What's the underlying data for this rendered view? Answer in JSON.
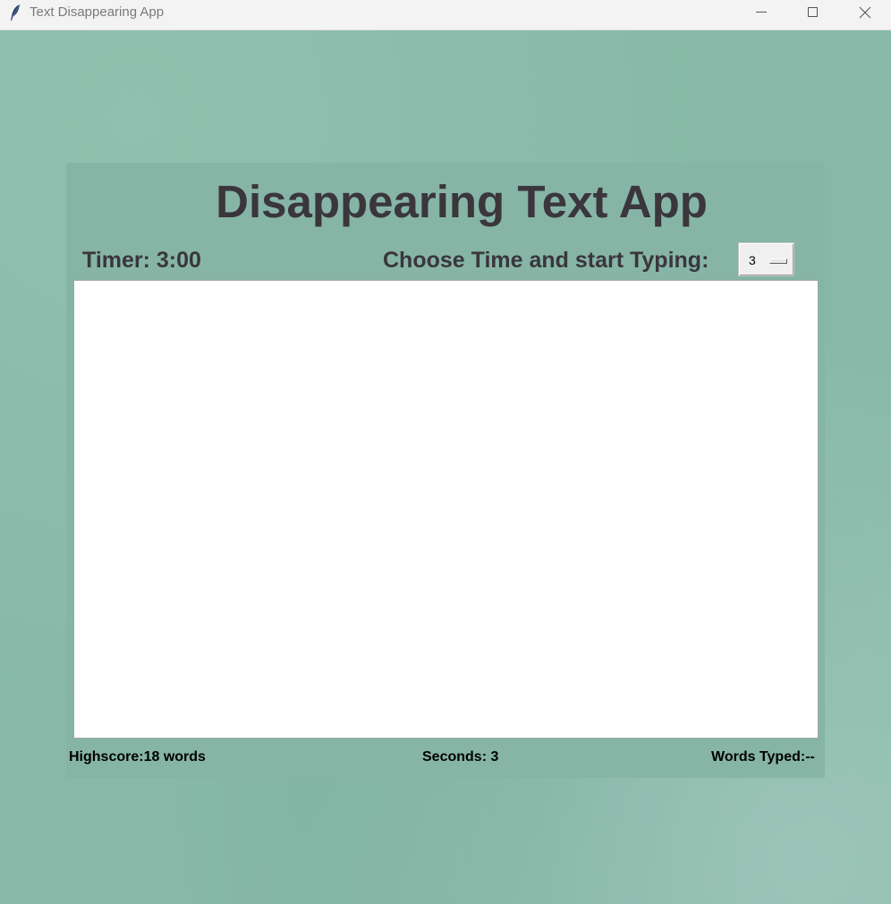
{
  "window": {
    "title": "Text Disappearing App",
    "icon": "feather-icon"
  },
  "app": {
    "heading": "Disappearing Text App",
    "timer": "Timer: 3:00",
    "choose_label": "Choose Time and start Typing:",
    "time_option": "3",
    "typing_area_text": ""
  },
  "stats": {
    "highscore": "Highscore:18 words",
    "seconds": "Seconds: 3",
    "words_typed": "Words Typed:--"
  },
  "colors": {
    "background": "#88b9a8",
    "panel": "#86b5a5",
    "heading_text": "#3a363c",
    "typing_area": "#ffffff"
  }
}
